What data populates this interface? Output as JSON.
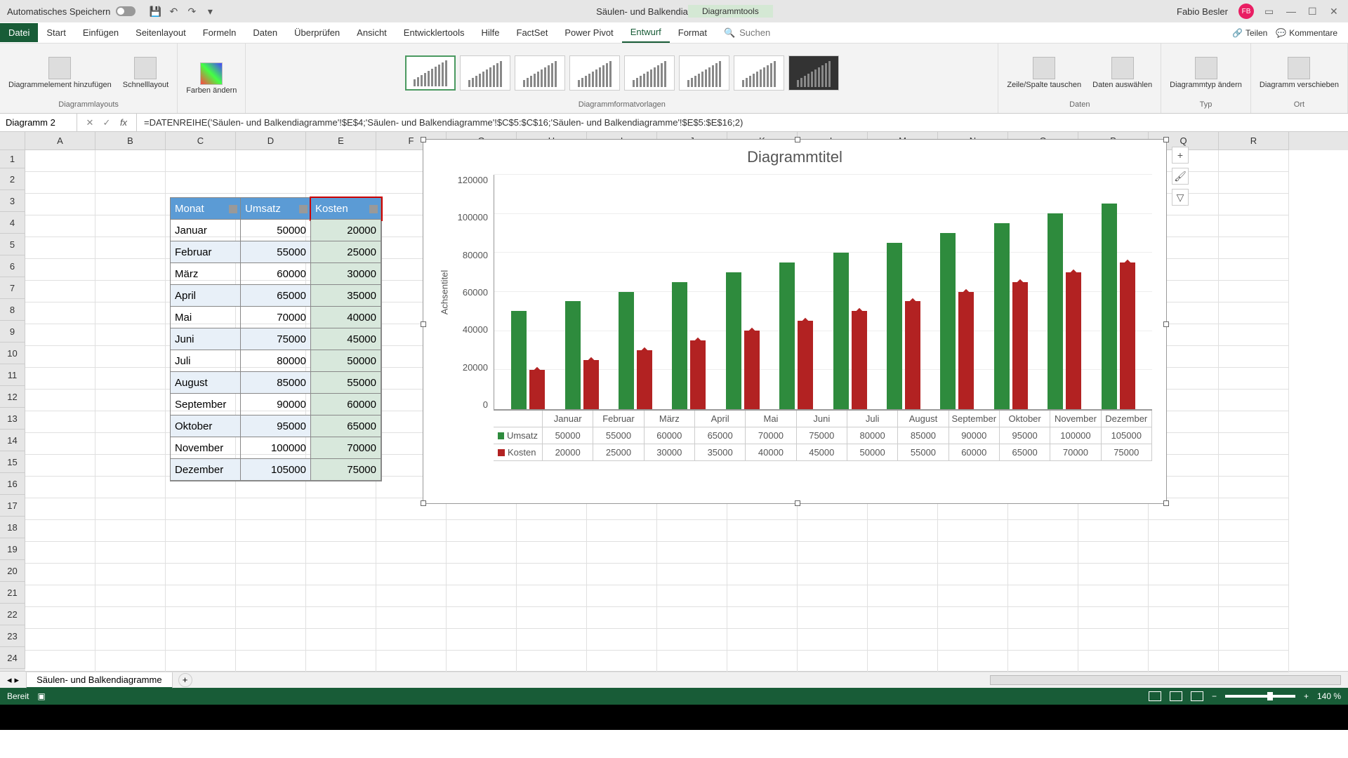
{
  "titlebar": {
    "autosave": "Automatisches Speichern",
    "doc_title": "Säulen- und Balkendiagramme - Excel",
    "chart_tools": "Diagrammtools",
    "user": "Fabio Besler",
    "user_initials": "FB"
  },
  "ribbon_tabs": [
    "Datei",
    "Start",
    "Einfügen",
    "Seitenlayout",
    "Formeln",
    "Daten",
    "Überprüfen",
    "Ansicht",
    "Entwicklertools",
    "Hilfe",
    "FactSet",
    "Power Pivot",
    "Entwurf",
    "Format"
  ],
  "ribbon_search": "Suchen",
  "ribbon_right": {
    "share": "Teilen",
    "comments": "Kommentare"
  },
  "ribbon_groups": {
    "layouts": {
      "btn1": "Diagrammelement hinzufügen",
      "btn2": "Schnelllayout",
      "label": "Diagrammlayouts"
    },
    "colors": {
      "btn": "Farben ändern"
    },
    "styles_label": "Diagrammformatvorlagen",
    "data": {
      "btn1": "Zeile/Spalte tauschen",
      "btn2": "Daten auswählen",
      "label": "Daten"
    },
    "type": {
      "btn": "Diagrammtyp ändern",
      "label": "Typ"
    },
    "location": {
      "btn": "Diagramm verschieben",
      "label": "Ort"
    }
  },
  "name_box": "Diagramm 2",
  "formula": "=DATENREIHE('Säulen- und Balkendiagramme'!$E$4;'Säulen- und Balkendiagramme'!$C$5:$C$16;'Säulen- und Balkendiagramme'!$E$5:$E$16;2)",
  "columns": [
    "A",
    "B",
    "C",
    "D",
    "E",
    "F",
    "G",
    "H",
    "I",
    "J",
    "K",
    "L",
    "M",
    "N",
    "O",
    "P",
    "Q",
    "R"
  ],
  "rows": [
    "1",
    "2",
    "3",
    "4",
    "5",
    "6",
    "7",
    "8",
    "9",
    "10",
    "11",
    "12",
    "13",
    "14",
    "15",
    "16",
    "17",
    "18",
    "19",
    "20",
    "21",
    "22",
    "23",
    "24"
  ],
  "table": {
    "headers": [
      "Monat",
      "Umsatz",
      "Kosten"
    ],
    "data": [
      [
        "Januar",
        "50000",
        "20000"
      ],
      [
        "Februar",
        "55000",
        "25000"
      ],
      [
        "März",
        "60000",
        "30000"
      ],
      [
        "April",
        "65000",
        "35000"
      ],
      [
        "Mai",
        "70000",
        "40000"
      ],
      [
        "Juni",
        "75000",
        "45000"
      ],
      [
        "Juli",
        "80000",
        "50000"
      ],
      [
        "August",
        "85000",
        "55000"
      ],
      [
        "September",
        "90000",
        "60000"
      ],
      [
        "Oktober",
        "95000",
        "65000"
      ],
      [
        "November",
        "100000",
        "70000"
      ],
      [
        "Dezember",
        "105000",
        "75000"
      ]
    ]
  },
  "chart_data": {
    "type": "bar",
    "title": "Diagrammtitel",
    "ylabel": "Achsentitel",
    "ylim": [
      0,
      120000
    ],
    "yticks": [
      "0",
      "20000",
      "40000",
      "60000",
      "80000",
      "100000",
      "120000"
    ],
    "categories": [
      "Januar",
      "Februar",
      "März",
      "April",
      "Mai",
      "Juni",
      "Juli",
      "August",
      "September",
      "Oktober",
      "November",
      "Dezember"
    ],
    "series": [
      {
        "name": "Umsatz",
        "color": "#2e8b3d",
        "values": [
          50000,
          55000,
          60000,
          65000,
          70000,
          75000,
          80000,
          85000,
          90000,
          95000,
          100000,
          105000
        ]
      },
      {
        "name": "Kosten",
        "color": "#b22222",
        "values": [
          20000,
          25000,
          30000,
          35000,
          40000,
          45000,
          50000,
          55000,
          60000,
          65000,
          70000,
          75000
        ]
      }
    ],
    "x_wrapped": [
      "Januar",
      "Februar",
      "März",
      "April",
      "Mai",
      "Juni",
      "Juli",
      "August",
      "September",
      "Oktober",
      "November",
      "Dezember"
    ]
  },
  "sheet_name": "Säulen- und Balkendiagramme",
  "status": {
    "ready": "Bereit",
    "zoom": "140 %"
  }
}
